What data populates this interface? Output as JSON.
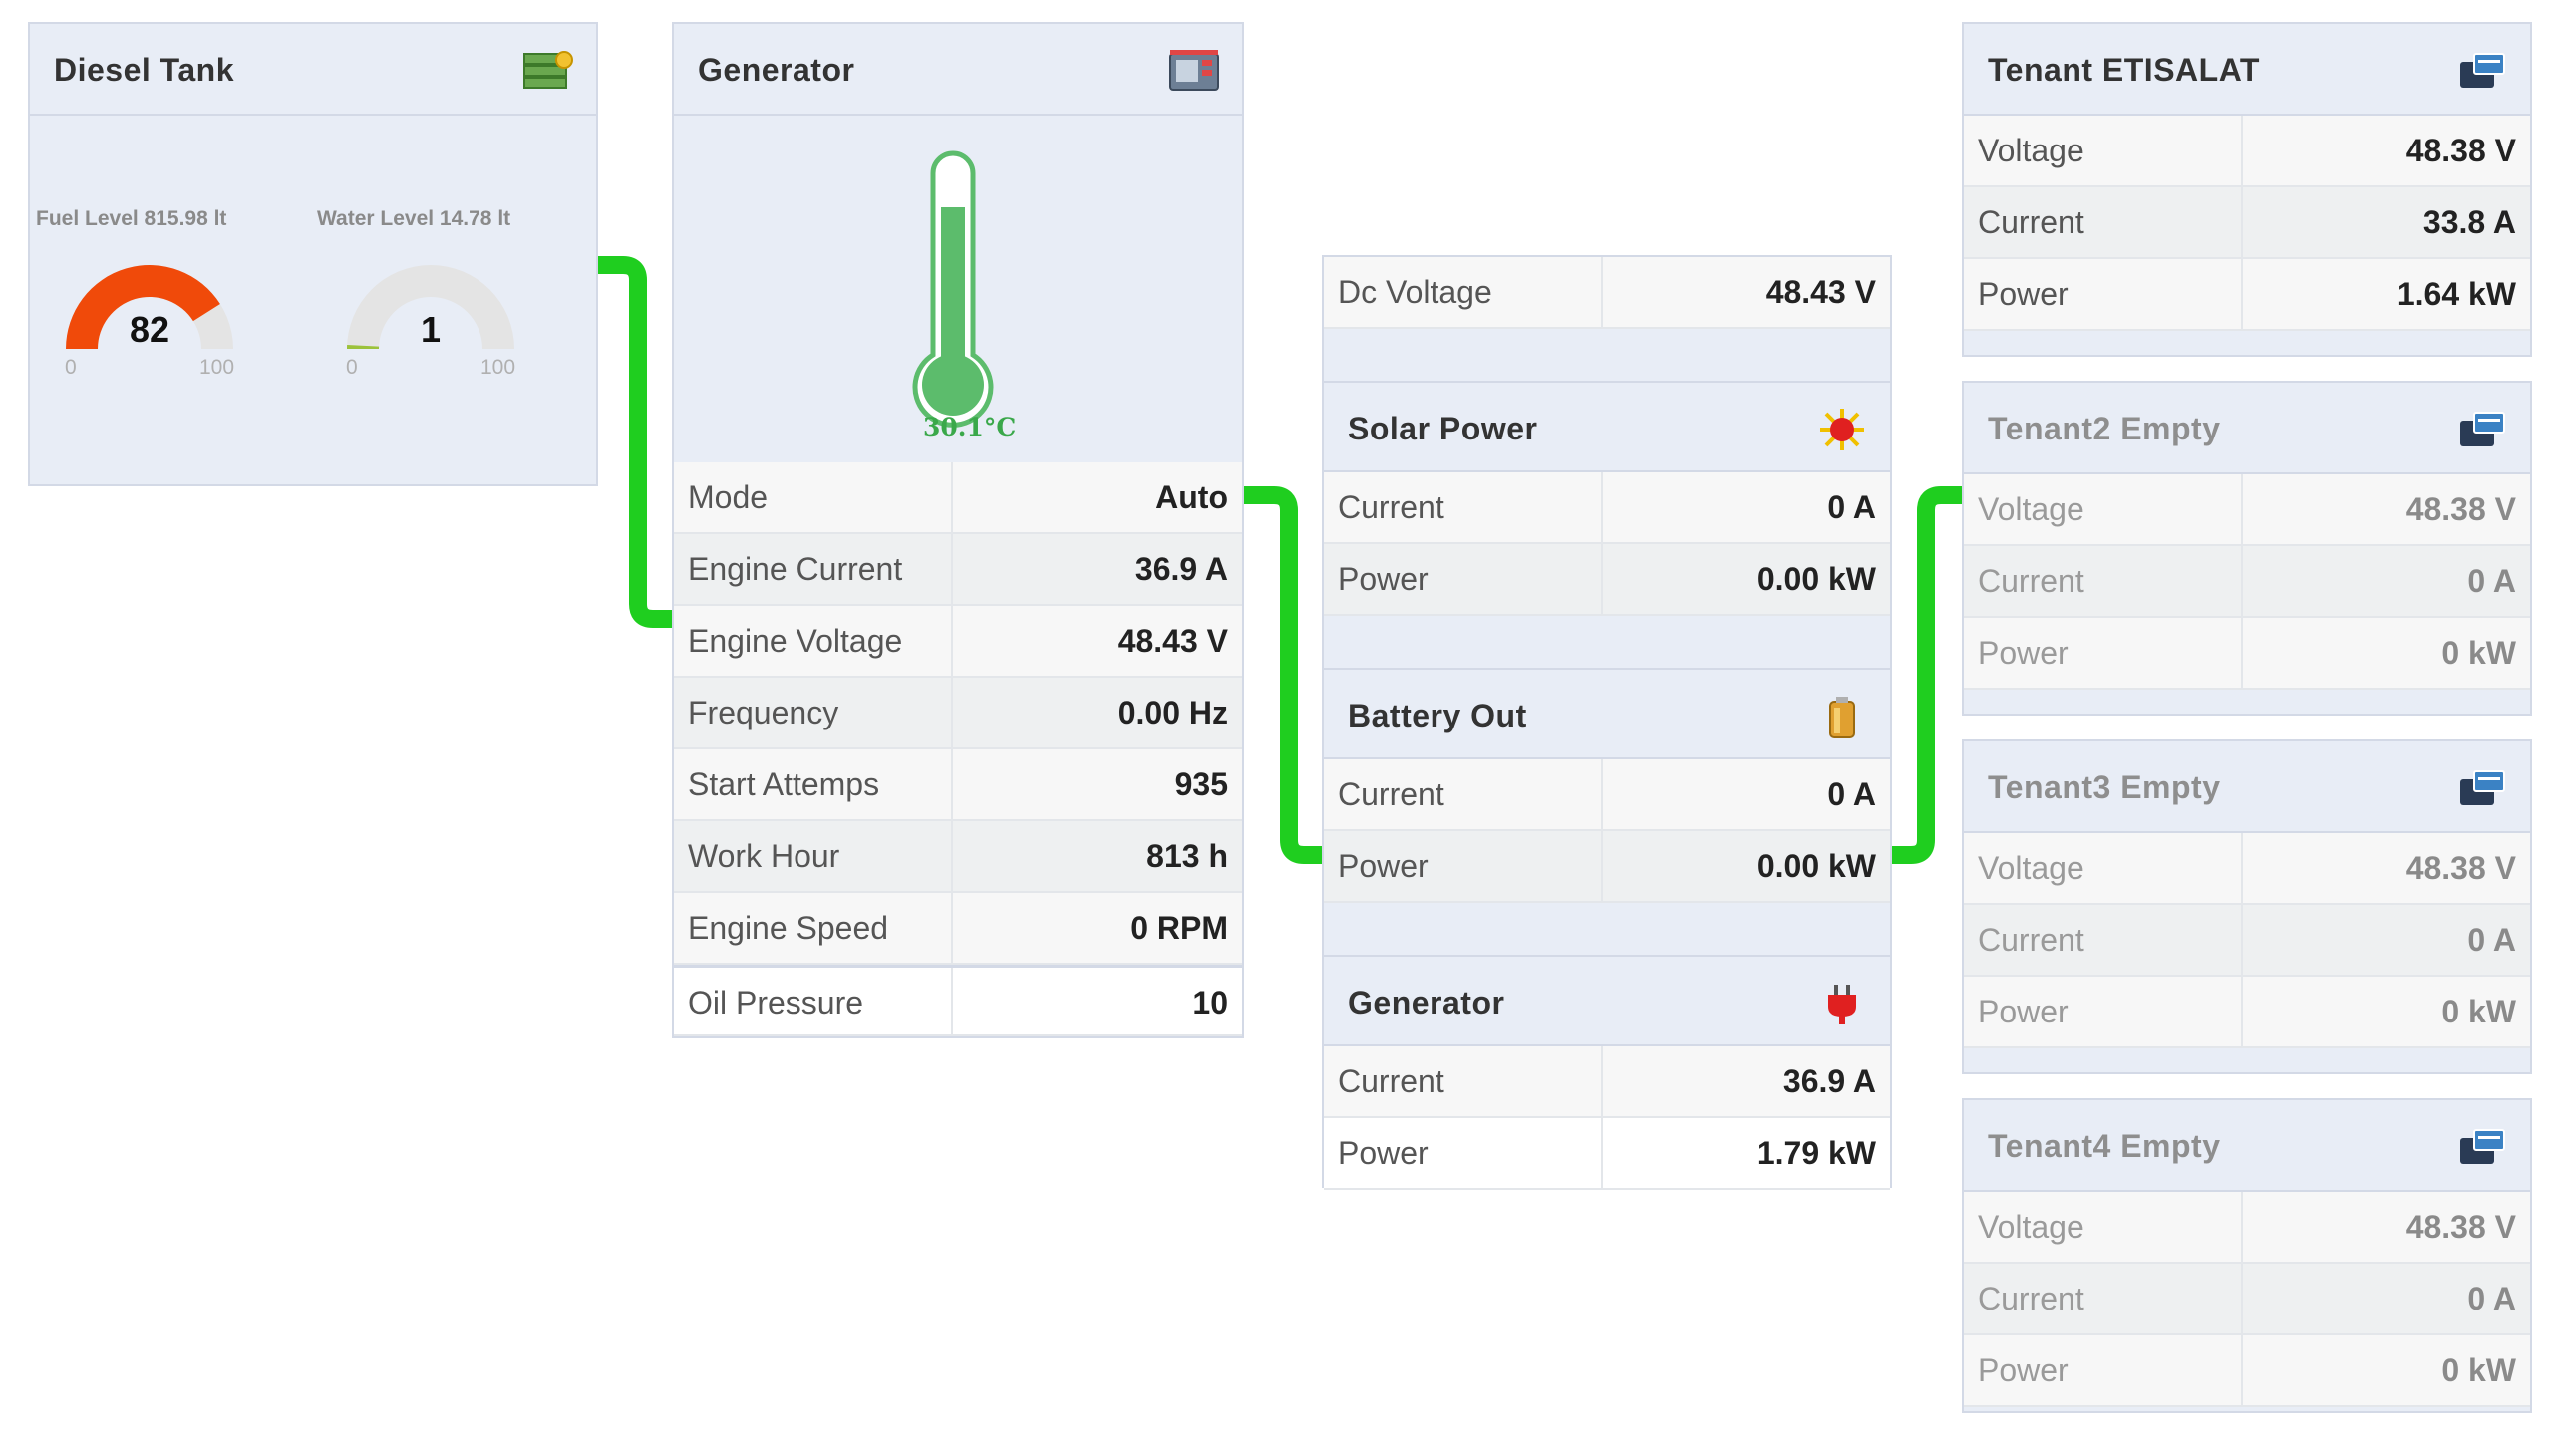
{
  "diesel": {
    "title": "Diesel Tank",
    "fuel_caption": "Fuel Level 815.98 lt",
    "fuel_value": "82",
    "fuel_min": "0",
    "fuel_max": "100",
    "fuel_level": 82,
    "water_caption": "Water Level 14.78 lt",
    "water_value": "1",
    "water_min": "0",
    "water_max": "100",
    "water_level": 1
  },
  "generator": {
    "title": "Generator",
    "temperature": "30.1°C",
    "rows": [
      {
        "label": "Mode",
        "value": "Auto"
      },
      {
        "label": "Engine Current",
        "value": "36.9 A"
      },
      {
        "label": "Engine Voltage",
        "value": "48.43 V"
      },
      {
        "label": "Frequency",
        "value": "0.00 Hz"
      },
      {
        "label": "Start Attemps",
        "value": "935"
      },
      {
        "label": "Work Hour",
        "value": "813 h"
      },
      {
        "label": "Engine Speed",
        "value": "0 RPM"
      },
      {
        "label": "Oil Pressure",
        "value": "10"
      }
    ]
  },
  "power": {
    "dc_label": "Dc Voltage",
    "dc_value": "48.43 V",
    "solar": {
      "title": "Solar Power",
      "current_label": "Current",
      "current": "0 A",
      "power_label": "Power",
      "power": "0.00 kW"
    },
    "battery": {
      "title": "Battery Out",
      "current_label": "Current",
      "current": "0 A",
      "power_label": "Power",
      "power": "0.00 kW"
    },
    "gen": {
      "title": "Generator",
      "current_label": "Current",
      "current": "36.9 A",
      "power_label": "Power",
      "power": "1.79 kW"
    }
  },
  "tenants": [
    {
      "title": "Tenant ETISALAT",
      "voltage_label": "Voltage",
      "voltage": "48.38 V",
      "current_label": "Current",
      "current": "33.8 A",
      "power_label": "Power",
      "power": "1.64 kW"
    },
    {
      "title": "Tenant2 Empty",
      "voltage_label": "Voltage",
      "voltage": "48.38 V",
      "current_label": "Current",
      "current": "0 A",
      "power_label": "Power",
      "power": "0 kW"
    },
    {
      "title": "Tenant3 Empty",
      "voltage_label": "Voltage",
      "voltage": "48.38 V",
      "current_label": "Current",
      "current": "0 A",
      "power_label": "Power",
      "power": "0 kW"
    },
    {
      "title": "Tenant4 Empty",
      "voltage_label": "Voltage",
      "voltage": "48.38 V",
      "current_label": "Current",
      "current": "0 A",
      "power_label": "Power",
      "power": "0 kW"
    }
  ],
  "colors": {
    "wire": "#1fce1f",
    "fuel_gauge": "#f04a0a",
    "water_gauge": "#9cc23a",
    "gauge_bg": "#e4e4e4",
    "thermometer": "#5cbc6c"
  }
}
